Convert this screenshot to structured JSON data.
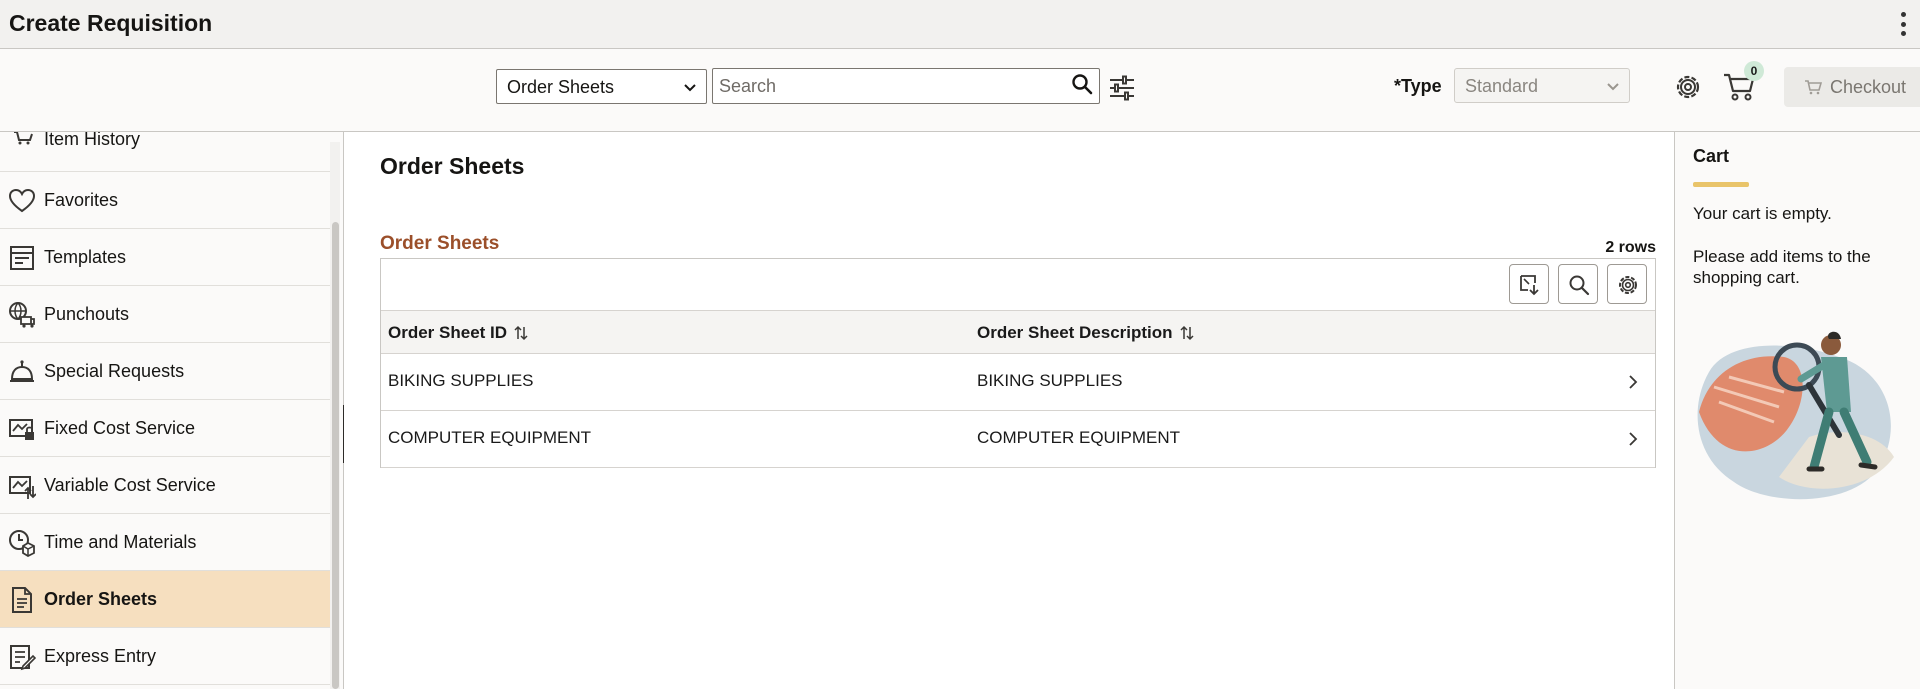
{
  "header": {
    "title": "Create Requisition"
  },
  "toolbar": {
    "source_select": "Order Sheets",
    "search_placeholder": "Search",
    "type_label": "*Type",
    "type_value": "Standard",
    "cart_count": "0",
    "checkout_label": "Checkout"
  },
  "sidebar": {
    "items": [
      {
        "label": "Item History",
        "icon": "cart-history-icon"
      },
      {
        "label": "Favorites",
        "icon": "heart-icon"
      },
      {
        "label": "Templates",
        "icon": "template-icon"
      },
      {
        "label": "Punchouts",
        "icon": "globe-truck-icon"
      },
      {
        "label": "Special Requests",
        "icon": "bell-icon"
      },
      {
        "label": "Fixed Cost Service",
        "icon": "fixed-cost-icon"
      },
      {
        "label": "Variable Cost Service",
        "icon": "variable-cost-icon"
      },
      {
        "label": "Time and Materials",
        "icon": "clock-box-icon"
      },
      {
        "label": "Order Sheets",
        "icon": "document-icon",
        "active": true
      },
      {
        "label": "Express Entry",
        "icon": "express-entry-icon"
      }
    ]
  },
  "main": {
    "page_title": "Order Sheets",
    "grid_title": "Order Sheets",
    "row_count": "2 rows",
    "columns": [
      "Order Sheet ID",
      "Order Sheet Description"
    ],
    "rows": [
      {
        "id": "BIKING SUPPLIES",
        "description": "BIKING SUPPLIES"
      },
      {
        "id": "COMPUTER EQUIPMENT",
        "description": "COMPUTER EQUIPMENT"
      }
    ]
  },
  "cart": {
    "title": "Cart",
    "empty_text": "Your cart is empty.",
    "hint_text": "Please add items to the shopping cart."
  },
  "colors": {
    "accent": "#9b4f2a",
    "active_item": "#f6dfbf",
    "underline": "#e9c46a"
  }
}
